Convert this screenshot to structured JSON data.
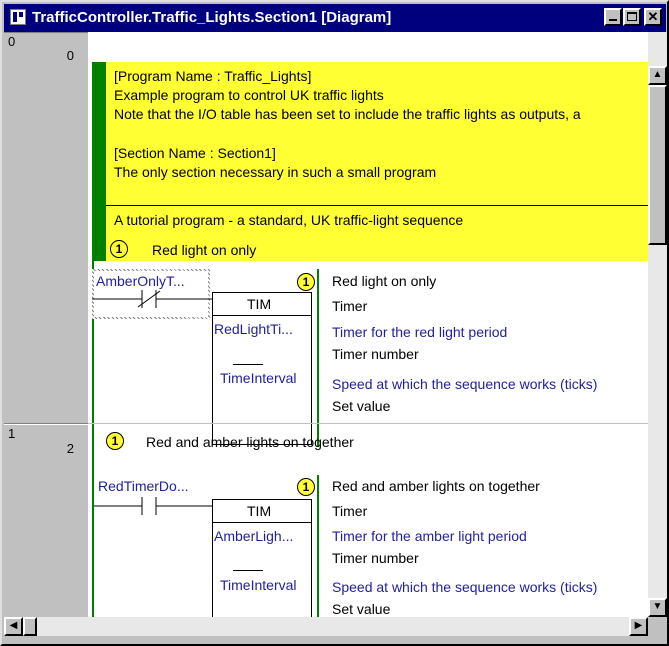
{
  "window": {
    "title": "TrafficController.Traffic_Lights.Section1 [Diagram]"
  },
  "gutter": {
    "rungs": [
      {
        "rung": "0",
        "step": "0"
      },
      {
        "rung": "1",
        "step": "2"
      }
    ]
  },
  "comment": {
    "lines": [
      "[Program Name : Traffic_Lights]",
      "Example program to control UK traffic lights",
      "Note that the I/O table has been set to include the traffic lights as outputs, a",
      "[Section Name : Section1]",
      "The only section necessary in such a small program",
      "A tutorial program - a standard, UK traffic-light sequence"
    ]
  },
  "rung0": {
    "badge": "1",
    "title": "Red light on only",
    "contact": "AmberOnlyT...",
    "instr": "TIM",
    "op1": "RedLightTi...",
    "op2": "TimeInterval",
    "c_name": "Red light on only",
    "c_type": "Timer",
    "c_op1": "Timer for the red light period",
    "c_op1b": "Timer number",
    "c_op2": "Speed at which the sequence works (ticks)",
    "c_op2b": "Set value"
  },
  "rung1": {
    "badge": "1",
    "title": "Red and amber lights on together",
    "contact": "RedTimerDo...",
    "instr": "TIM",
    "op1": "AmberLigh...",
    "op2": "TimeInterval",
    "c_name": "Red and amber lights on together",
    "c_type": "Timer",
    "c_op1": "Timer for the amber light period",
    "c_op1b": "Timer number",
    "c_op2": "Speed at which the sequence works (ticks)",
    "c_op2b": "Set value"
  },
  "colors": {
    "titlebar": "#00007f",
    "comment_bg": "#ffff33",
    "rail": "#008000",
    "operand_text": "#1f1fa0"
  }
}
